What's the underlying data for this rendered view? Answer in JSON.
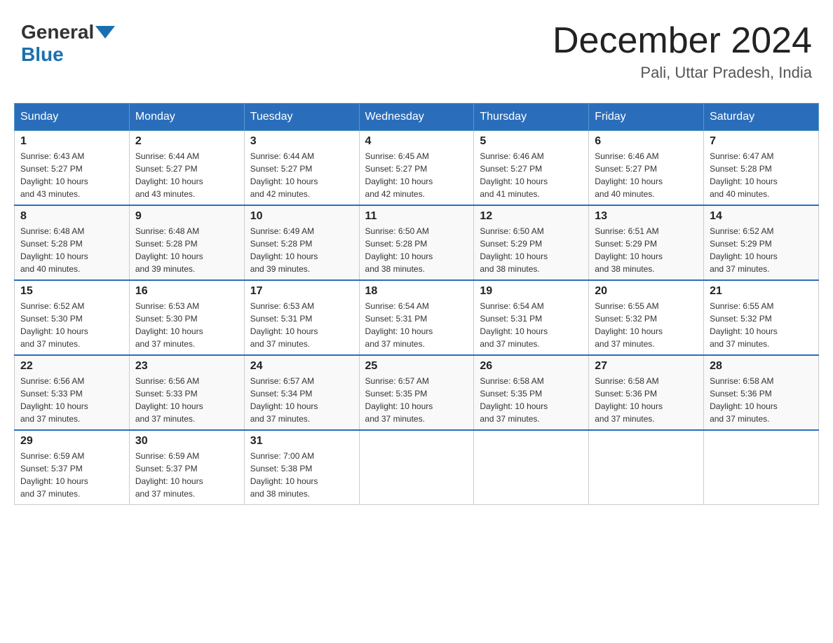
{
  "header": {
    "logo_general": "General",
    "logo_blue": "Blue",
    "month_title": "December 2024",
    "location": "Pali, Uttar Pradesh, India"
  },
  "days_of_week": [
    "Sunday",
    "Monday",
    "Tuesday",
    "Wednesday",
    "Thursday",
    "Friday",
    "Saturday"
  ],
  "weeks": [
    [
      {
        "day": "1",
        "sunrise": "6:43 AM",
        "sunset": "5:27 PM",
        "daylight": "10 hours and 43 minutes."
      },
      {
        "day": "2",
        "sunrise": "6:44 AM",
        "sunset": "5:27 PM",
        "daylight": "10 hours and 43 minutes."
      },
      {
        "day": "3",
        "sunrise": "6:44 AM",
        "sunset": "5:27 PM",
        "daylight": "10 hours and 42 minutes."
      },
      {
        "day": "4",
        "sunrise": "6:45 AM",
        "sunset": "5:27 PM",
        "daylight": "10 hours and 42 minutes."
      },
      {
        "day": "5",
        "sunrise": "6:46 AM",
        "sunset": "5:27 PM",
        "daylight": "10 hours and 41 minutes."
      },
      {
        "day": "6",
        "sunrise": "6:46 AM",
        "sunset": "5:27 PM",
        "daylight": "10 hours and 40 minutes."
      },
      {
        "day": "7",
        "sunrise": "6:47 AM",
        "sunset": "5:28 PM",
        "daylight": "10 hours and 40 minutes."
      }
    ],
    [
      {
        "day": "8",
        "sunrise": "6:48 AM",
        "sunset": "5:28 PM",
        "daylight": "10 hours and 40 minutes."
      },
      {
        "day": "9",
        "sunrise": "6:48 AM",
        "sunset": "5:28 PM",
        "daylight": "10 hours and 39 minutes."
      },
      {
        "day": "10",
        "sunrise": "6:49 AM",
        "sunset": "5:28 PM",
        "daylight": "10 hours and 39 minutes."
      },
      {
        "day": "11",
        "sunrise": "6:50 AM",
        "sunset": "5:28 PM",
        "daylight": "10 hours and 38 minutes."
      },
      {
        "day": "12",
        "sunrise": "6:50 AM",
        "sunset": "5:29 PM",
        "daylight": "10 hours and 38 minutes."
      },
      {
        "day": "13",
        "sunrise": "6:51 AM",
        "sunset": "5:29 PM",
        "daylight": "10 hours and 38 minutes."
      },
      {
        "day": "14",
        "sunrise": "6:52 AM",
        "sunset": "5:29 PM",
        "daylight": "10 hours and 37 minutes."
      }
    ],
    [
      {
        "day": "15",
        "sunrise": "6:52 AM",
        "sunset": "5:30 PM",
        "daylight": "10 hours and 37 minutes."
      },
      {
        "day": "16",
        "sunrise": "6:53 AM",
        "sunset": "5:30 PM",
        "daylight": "10 hours and 37 minutes."
      },
      {
        "day": "17",
        "sunrise": "6:53 AM",
        "sunset": "5:31 PM",
        "daylight": "10 hours and 37 minutes."
      },
      {
        "day": "18",
        "sunrise": "6:54 AM",
        "sunset": "5:31 PM",
        "daylight": "10 hours and 37 minutes."
      },
      {
        "day": "19",
        "sunrise": "6:54 AM",
        "sunset": "5:31 PM",
        "daylight": "10 hours and 37 minutes."
      },
      {
        "day": "20",
        "sunrise": "6:55 AM",
        "sunset": "5:32 PM",
        "daylight": "10 hours and 37 minutes."
      },
      {
        "day": "21",
        "sunrise": "6:55 AM",
        "sunset": "5:32 PM",
        "daylight": "10 hours and 37 minutes."
      }
    ],
    [
      {
        "day": "22",
        "sunrise": "6:56 AM",
        "sunset": "5:33 PM",
        "daylight": "10 hours and 37 minutes."
      },
      {
        "day": "23",
        "sunrise": "6:56 AM",
        "sunset": "5:33 PM",
        "daylight": "10 hours and 37 minutes."
      },
      {
        "day": "24",
        "sunrise": "6:57 AM",
        "sunset": "5:34 PM",
        "daylight": "10 hours and 37 minutes."
      },
      {
        "day": "25",
        "sunrise": "6:57 AM",
        "sunset": "5:35 PM",
        "daylight": "10 hours and 37 minutes."
      },
      {
        "day": "26",
        "sunrise": "6:58 AM",
        "sunset": "5:35 PM",
        "daylight": "10 hours and 37 minutes."
      },
      {
        "day": "27",
        "sunrise": "6:58 AM",
        "sunset": "5:36 PM",
        "daylight": "10 hours and 37 minutes."
      },
      {
        "day": "28",
        "sunrise": "6:58 AM",
        "sunset": "5:36 PM",
        "daylight": "10 hours and 37 minutes."
      }
    ],
    [
      {
        "day": "29",
        "sunrise": "6:59 AM",
        "sunset": "5:37 PM",
        "daylight": "10 hours and 37 minutes."
      },
      {
        "day": "30",
        "sunrise": "6:59 AM",
        "sunset": "5:37 PM",
        "daylight": "10 hours and 37 minutes."
      },
      {
        "day": "31",
        "sunrise": "7:00 AM",
        "sunset": "5:38 PM",
        "daylight": "10 hours and 38 minutes."
      },
      null,
      null,
      null,
      null
    ]
  ],
  "labels": {
    "sunrise": "Sunrise:",
    "sunset": "Sunset:",
    "daylight": "Daylight:"
  }
}
